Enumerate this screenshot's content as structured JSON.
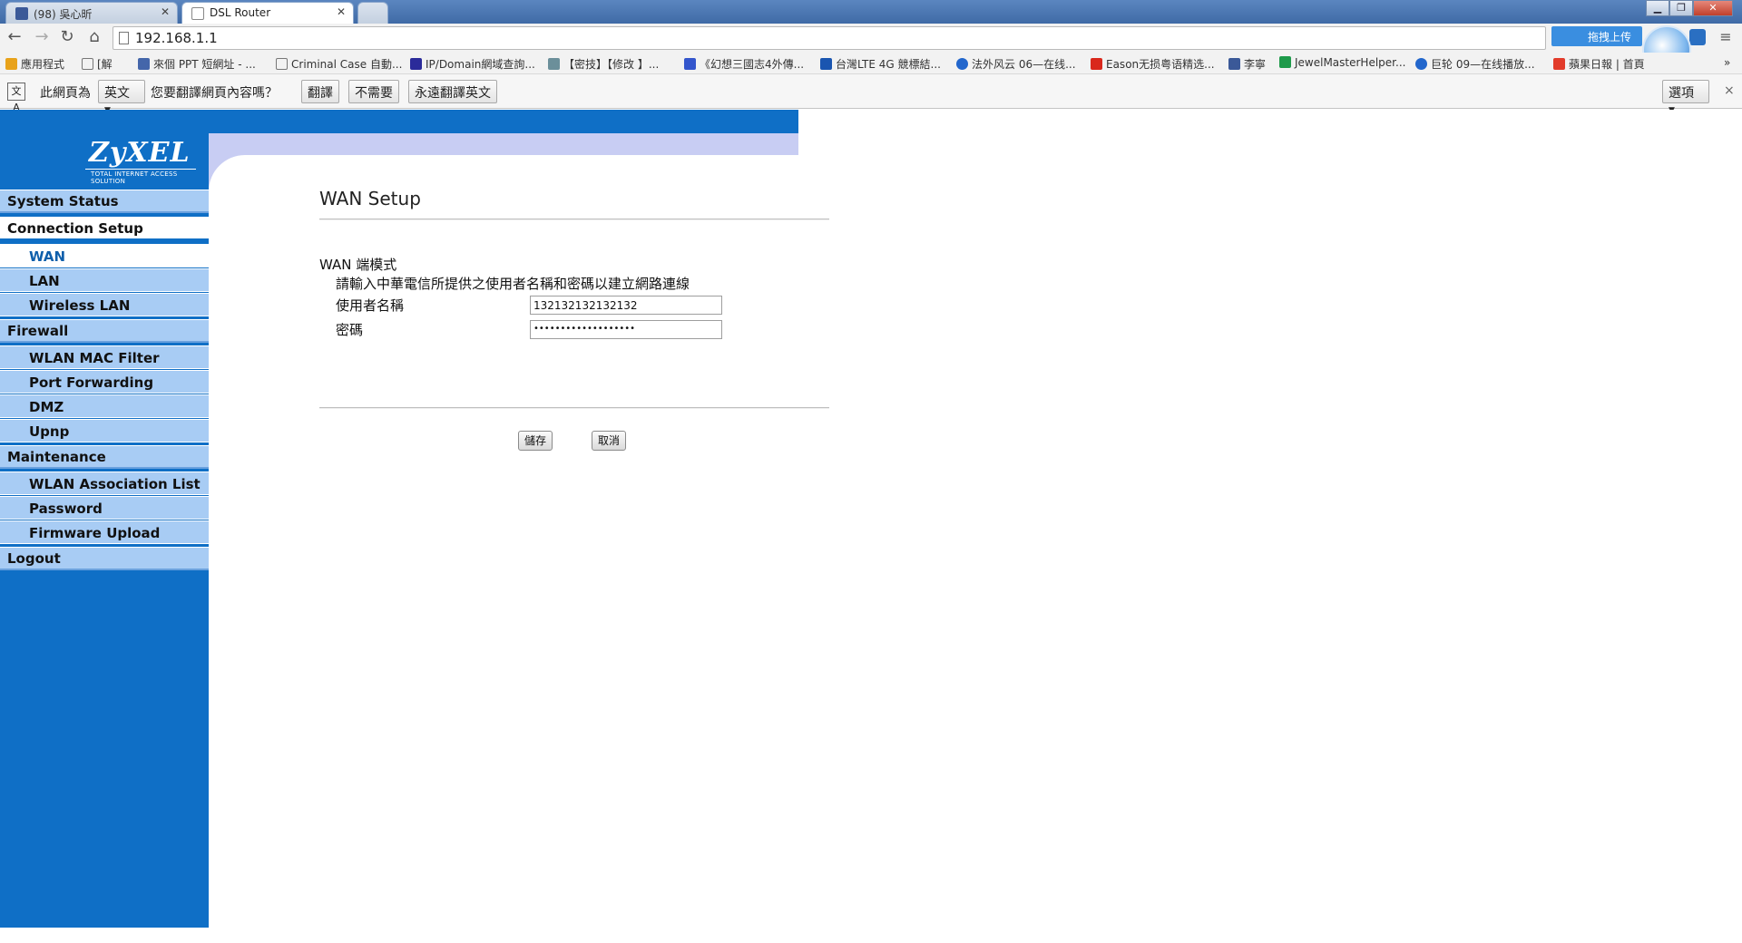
{
  "browser": {
    "tabs": [
      {
        "label": "(98) 吳心昕",
        "active": false
      },
      {
        "label": "DSL Router",
        "active": true
      }
    ],
    "address": "192.168.1.1",
    "upload_label": "拖拽上传",
    "window_buttons": {
      "minimize": "▁",
      "maximize": "❐",
      "close": "✕"
    }
  },
  "bookmarks": [
    {
      "label": "應用程式",
      "icon": "apps-grid-icon",
      "color": "#e8a21a"
    },
    {
      "label": "[解",
      "icon": "page-icon",
      "color": "#ffffff"
    },
    {
      "label": "來個 PPT 短網址 - ...",
      "icon": "ppt-icon",
      "color": "#4466aa"
    },
    {
      "label": "Criminal Case 自動...",
      "icon": "page-icon",
      "color": "#ffffff"
    },
    {
      "label": "IP/Domain網域查詢...",
      "icon": "ip-icon",
      "color": "#2b2b9a"
    },
    {
      "label": "【密技】【修改 】...",
      "icon": "bird-icon",
      "color": "#6b8f9a"
    },
    {
      "label": "《幻想三國志4外傳...",
      "icon": "game-icon",
      "color": "#3355cc"
    },
    {
      "label": "台灣LTE 4G 競標結...",
      "icon": "mobile-icon",
      "color": "#1a55b0"
    },
    {
      "label": "法外风云 06—在线...",
      "icon": "play-icon",
      "color": "#2266cc"
    },
    {
      "label": "Eason无损粤语精选...",
      "icon": "huawei-icon",
      "color": "#d9281c"
    },
    {
      "label": "李寧",
      "icon": "facebook-icon",
      "color": "#3b5998"
    },
    {
      "label": "JewelMasterHelper...",
      "icon": "sheet-icon",
      "color": "#1e9a4a"
    },
    {
      "label": "巨轮 09—在线播放...",
      "icon": "play-icon",
      "color": "#2266cc"
    },
    {
      "label": "蘋果日報 | 首頁",
      "icon": "apple-daily-icon",
      "color": "#e23b2a"
    }
  ],
  "translate_bar": {
    "prefix": "此網頁為",
    "language": "英文",
    "question": "您要翻譯網頁內容嗎？",
    "translate": "翻譯",
    "nope": "不需要",
    "always": "永遠翻譯英文",
    "options": "選項",
    "close": "×"
  },
  "router": {
    "logo": "ZyXEL",
    "logo_sub": "TOTAL INTERNET ACCESS SOLUTION",
    "nav": [
      {
        "label": "System Status",
        "type": "header",
        "active": false
      },
      {
        "label": "Connection Setup",
        "type": "header",
        "active": true
      },
      {
        "label": "WAN",
        "type": "sub",
        "active": true
      },
      {
        "label": "LAN",
        "type": "sub",
        "active": false
      },
      {
        "label": "Wireless LAN",
        "type": "sub",
        "active": false
      },
      {
        "label": "Firewall",
        "type": "header",
        "active": false
      },
      {
        "label": "WLAN MAC Filter",
        "type": "sub",
        "active": false
      },
      {
        "label": "Port Forwarding",
        "type": "sub",
        "active": false
      },
      {
        "label": "DMZ",
        "type": "sub",
        "active": false
      },
      {
        "label": "Upnp",
        "type": "sub",
        "active": false
      },
      {
        "label": "Maintenance",
        "type": "header",
        "active": false
      },
      {
        "label": "WLAN Association List",
        "type": "sub",
        "active": false
      },
      {
        "label": "Password",
        "type": "sub",
        "active": false
      },
      {
        "label": "Firmware Upload",
        "type": "sub",
        "active": false
      },
      {
        "label": "Logout",
        "type": "header",
        "active": false
      }
    ],
    "page_title": "WAN Setup",
    "mode_label": "WAN 端模式",
    "instruction": "請輸入中華電信所提供之使用者名稱和密碼以建立網路連線",
    "username_label": "使用者名稱",
    "username_value": "132132132132132",
    "password_label": "密碼",
    "password_value": "•••••••••••••••••••",
    "save": "儲存",
    "cancel": "取消"
  }
}
